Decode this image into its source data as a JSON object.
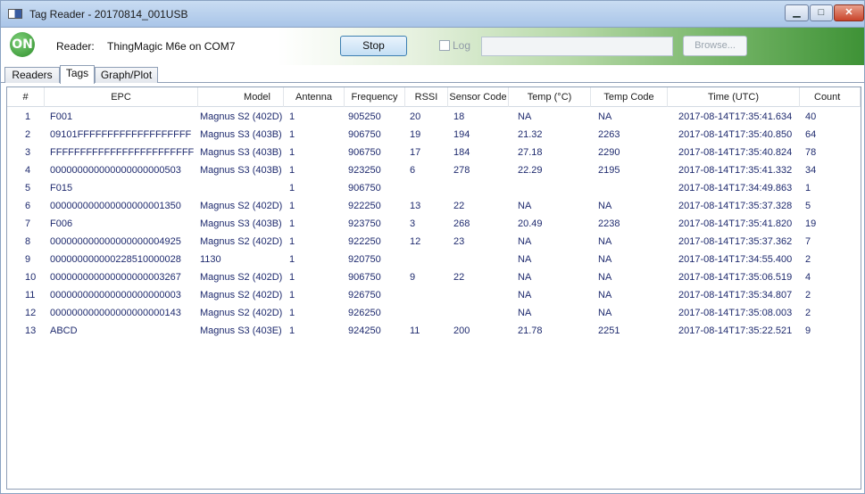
{
  "window": {
    "title": "Tag Reader - 20170814_001USB",
    "min_label": "▁",
    "max_label": "□",
    "close_label": "✕"
  },
  "toolbar": {
    "logo_text": "ON",
    "reader_label": "Reader:",
    "reader_value": "ThingMagic M6e on COM7",
    "stop_label": "Stop",
    "log_label": "Log",
    "log_checked": false,
    "path_value": "",
    "browse_label": "Browse..."
  },
  "tabs": [
    {
      "label": "Readers",
      "active": false
    },
    {
      "label": "Tags",
      "active": true
    },
    {
      "label": "Graph/Plot",
      "active": false
    }
  ],
  "grid": {
    "columns": [
      "#",
      "EPC",
      "Model",
      "Antenna",
      "Frequency",
      "RSSI",
      "Sensor Code",
      "Temp (°C)",
      "Temp Code",
      "Time (UTC)",
      "Count"
    ],
    "rows": [
      [
        "1",
        "F001",
        "Magnus S2 (402D)",
        "1",
        "905250",
        "20",
        "18",
        "NA",
        "NA",
        "2017-08-14T17:35:41.634",
        "40"
      ],
      [
        "2",
        "09101FFFFFFFFFFFFFFFFFFF",
        "Magnus S3 (403B)",
        "1",
        "906750",
        "19",
        "194",
        "21.32",
        "2263",
        "2017-08-14T17:35:40.850",
        "64"
      ],
      [
        "3",
        "FFFFFFFFFFFFFFFFFFFFFFFF",
        "Magnus S3 (403B)",
        "1",
        "906750",
        "17",
        "184",
        "27.18",
        "2290",
        "2017-08-14T17:35:40.824",
        "78"
      ],
      [
        "4",
        "000000000000000000000503",
        "Magnus S3 (403B)",
        "1",
        "923250",
        "6",
        "278",
        "22.29",
        "2195",
        "2017-08-14T17:35:41.332",
        "34"
      ],
      [
        "5",
        "F015",
        "",
        "1",
        "906750",
        "",
        "",
        "",
        "",
        "2017-08-14T17:34:49.863",
        "1"
      ],
      [
        "6",
        "000000000000000000001350",
        "Magnus S2 (402D)",
        "1",
        "922250",
        "13",
        "22",
        "NA",
        "NA",
        "2017-08-14T17:35:37.328",
        "5"
      ],
      [
        "7",
        "F006",
        "Magnus S3 (403B)",
        "1",
        "923750",
        "3",
        "268",
        "20.49",
        "2238",
        "2017-08-14T17:35:41.820",
        "19"
      ],
      [
        "8",
        "000000000000000000004925",
        "Magnus S2 (402D)",
        "1",
        "922250",
        "12",
        "23",
        "NA",
        "NA",
        "2017-08-14T17:35:37.362",
        "7"
      ],
      [
        "9",
        "000000000000228510000028",
        "1130",
        "1",
        "920750",
        "",
        "",
        "NA",
        "NA",
        "2017-08-14T17:34:55.400",
        "2"
      ],
      [
        "10",
        "000000000000000000003267",
        "Magnus S2 (402D)",
        "1",
        "906750",
        "9",
        "22",
        "NA",
        "NA",
        "2017-08-14T17:35:06.519",
        "4"
      ],
      [
        "11",
        "000000000000000000000003",
        "Magnus S2 (402D)",
        "1",
        "926750",
        "",
        "",
        "NA",
        "NA",
        "2017-08-14T17:35:34.807",
        "2"
      ],
      [
        "12",
        "000000000000000000000143",
        "Magnus S2 (402D)",
        "1",
        "926250",
        "",
        "",
        "NA",
        "NA",
        "2017-08-14T17:35:08.003",
        "2"
      ],
      [
        "13",
        "ABCD",
        "Magnus S3 (403E)",
        "1",
        "924250",
        "11",
        "200",
        "21.78",
        "2251",
        "2017-08-14T17:35:22.521",
        "9"
      ]
    ]
  }
}
